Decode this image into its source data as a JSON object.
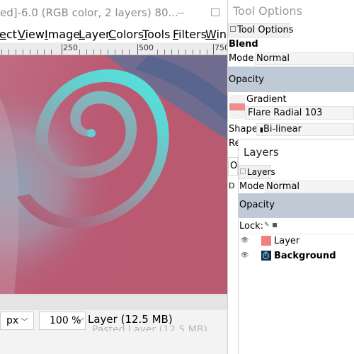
{
  "image_window": {
    "title": "ed]-6.0 (RGB color, 2 layers) 80...",
    "menu": [
      "ect",
      "View",
      "Image",
      "Layer",
      "Colors",
      "Tools",
      "Filters",
      "Wind"
    ],
    "ruler": {
      "labels": [
        "250",
        "500",
        "750"
      ]
    },
    "status": {
      "unit": "px",
      "zoom": "100 %",
      "layer_info": "Layer (12.5 MB)",
      "ghost_text": "Pasted Layer (12.5 MB)"
    }
  },
  "tool_options": {
    "title": "Tool Options",
    "tab_label": "Tool Options",
    "section_blend": "Blend",
    "mode_label": "Mode:",
    "mode_value": "Normal",
    "opacity_label": "Opacity",
    "gradient_label": "Gradient",
    "gradient_value": "Flare Radial 103",
    "shape_label": "Shape:",
    "shape_value": "Bi-linear",
    "cut1": "Re",
    "cut2": "O",
    "cut3": "D"
  },
  "layers": {
    "title": "Layers",
    "tab_label": "Layers",
    "mode_label": "Mode:",
    "mode_value": "Normal",
    "opacity_label": "Opacity",
    "lock_label": "Lock:",
    "items": [
      {
        "name": "Layer",
        "thumb": "#f08080",
        "selected": false
      },
      {
        "name": "Background",
        "thumb": "swirl",
        "selected": false
      }
    ]
  },
  "colors": {
    "canvas_pink": "#c05570",
    "canvas_blue": "#546a8e",
    "swirl_cyan": "#4fe8e0",
    "opacity_bar": "#bfcad6"
  }
}
